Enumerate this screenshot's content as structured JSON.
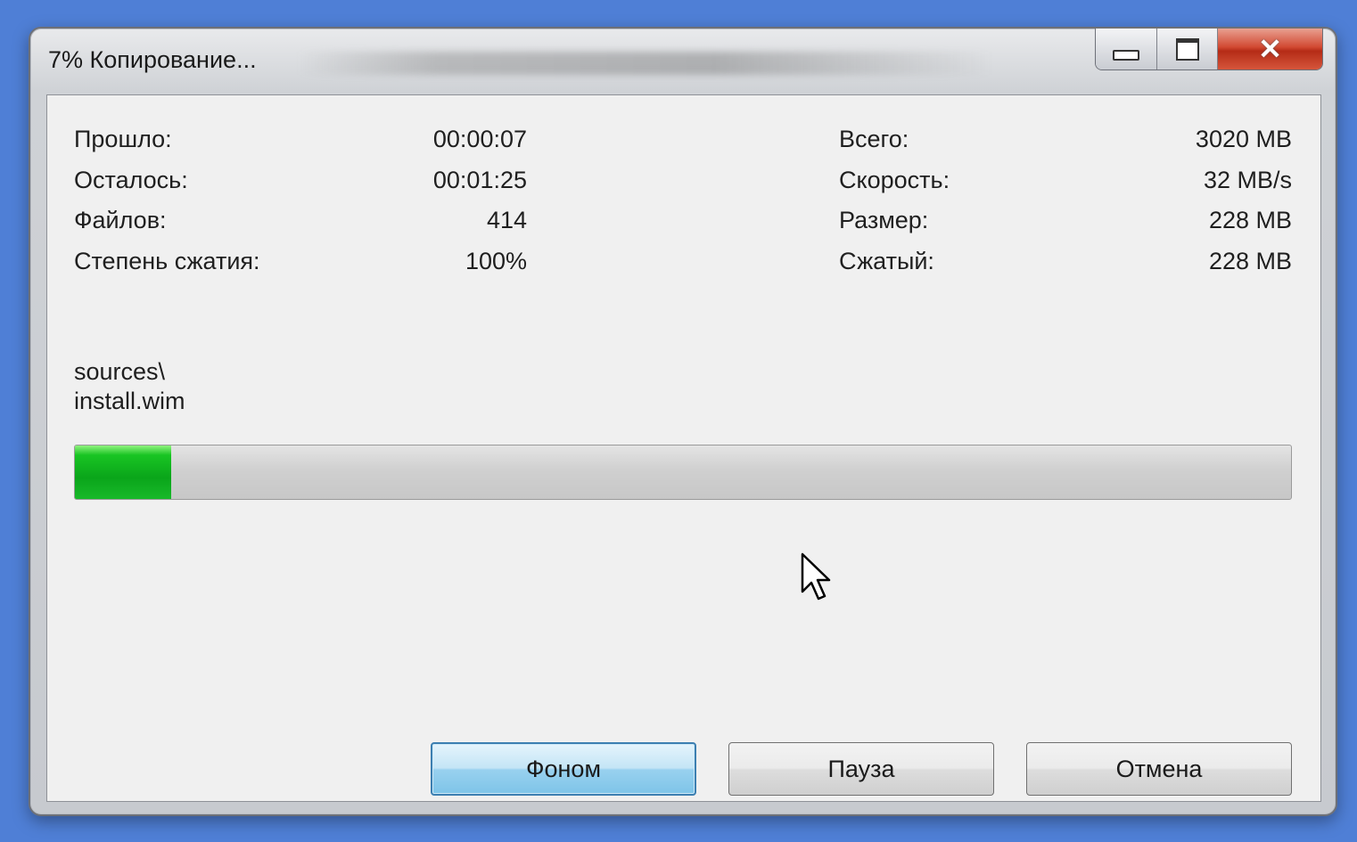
{
  "window": {
    "title": "7% Копирование...",
    "controls": {
      "minimize": "minimize-icon",
      "maximize": "maximize-icon",
      "close": "close-icon"
    }
  },
  "stats_left": [
    {
      "label": "Прошло:",
      "value": "00:00:07"
    },
    {
      "label": "Осталось:",
      "value": "00:01:25"
    },
    {
      "label": "Файлов:",
      "value": "414"
    },
    {
      "label": "Степень сжатия:",
      "value": "100%"
    }
  ],
  "stats_right": [
    {
      "label": "Всего:",
      "value": "3020 MB"
    },
    {
      "label": "Скорость:",
      "value": "32 MB/s"
    },
    {
      "label": "Размер:",
      "value": "228 MB"
    },
    {
      "label": "Сжатый:",
      "value": "228 MB"
    }
  ],
  "current_file": {
    "folder": "sources\\",
    "name": "install.wim"
  },
  "progress": {
    "fraction": 0.079,
    "color": "#0aa51a"
  },
  "buttons": {
    "background": "Фоном",
    "pause": "Пауза",
    "cancel": "Отмена"
  },
  "colors": {
    "desktop": "#4f7fd6",
    "close_button": "#d24a33",
    "default_button_border": "#3c7fb1"
  }
}
